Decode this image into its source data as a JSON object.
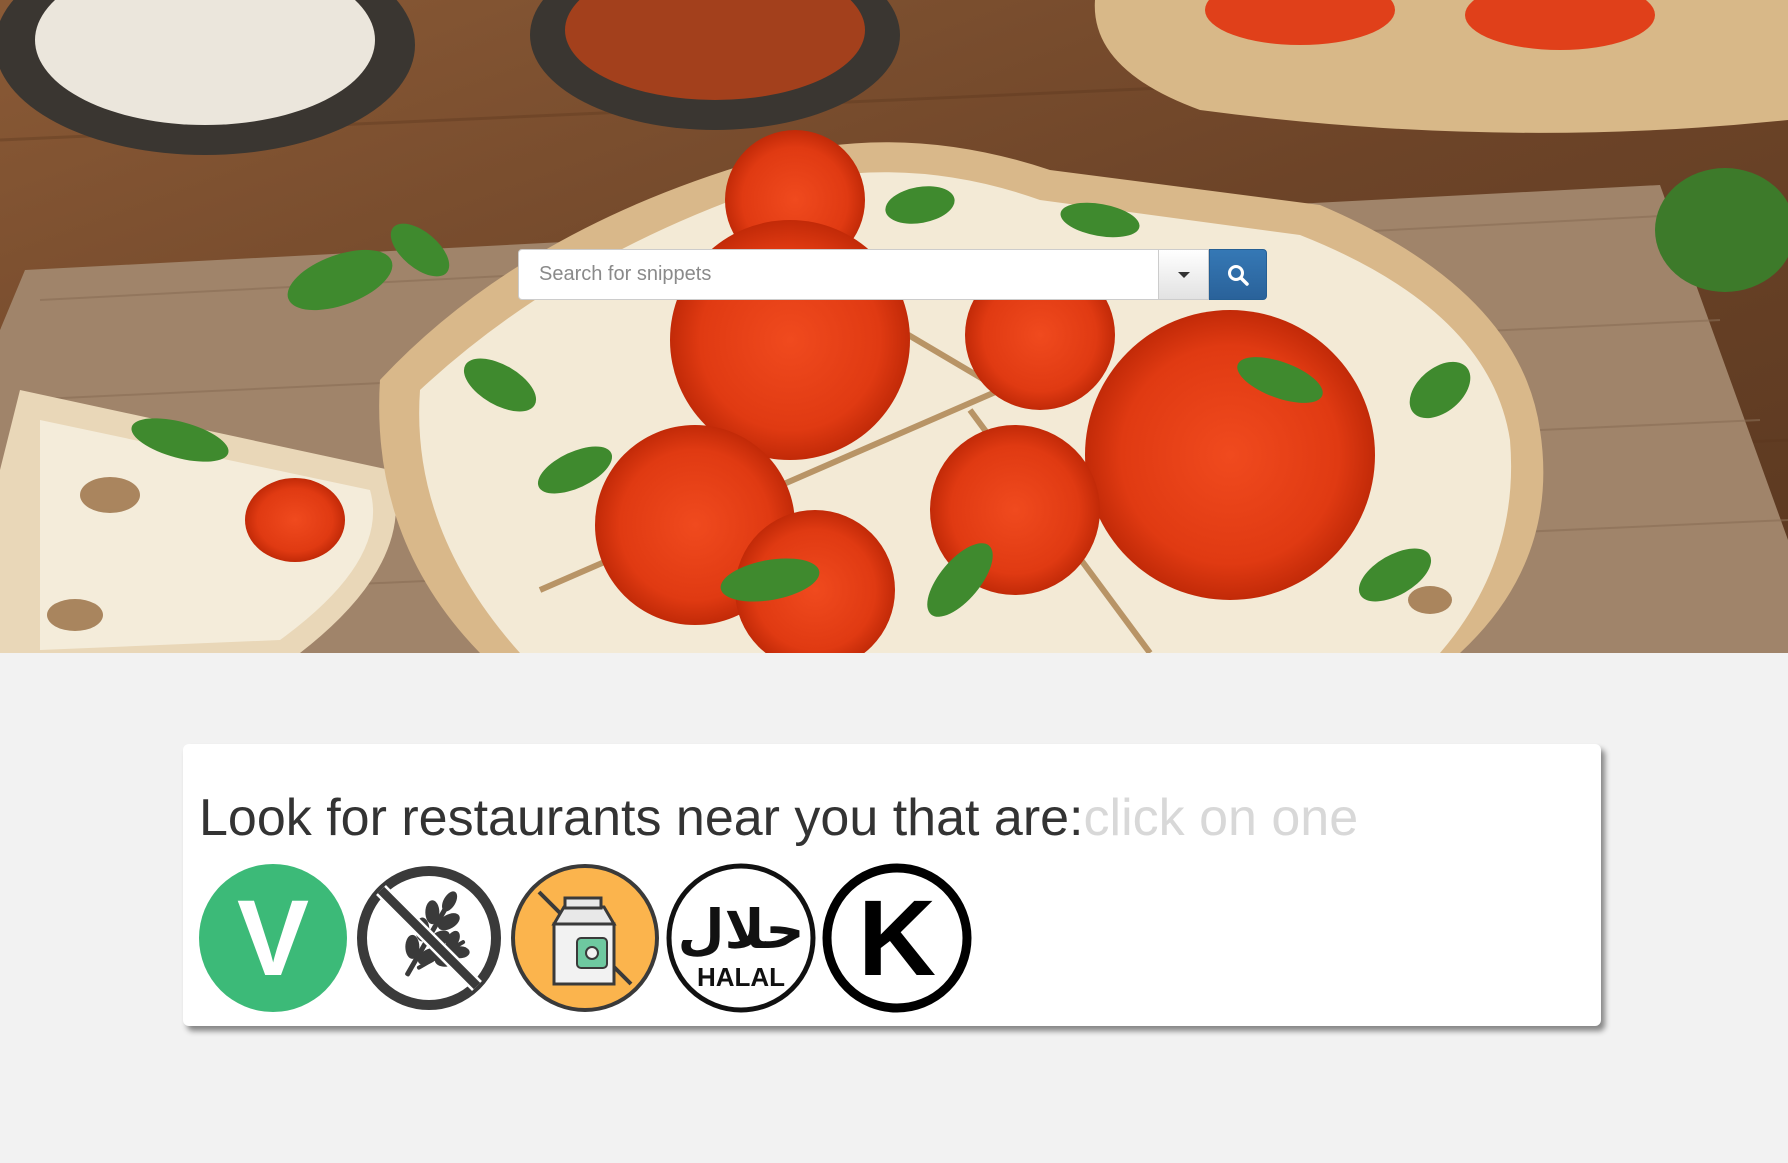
{
  "search": {
    "placeholder": "Search for snippets",
    "value": ""
  },
  "filter": {
    "heading": "Look for restaurants near you that are:",
    "hint": "click on one",
    "options": [
      {
        "icon": "vegan-icon",
        "letter": "V",
        "color": "#3cba78"
      },
      {
        "icon": "gluten-free-icon"
      },
      {
        "icon": "dairy-free-icon",
        "color": "#fbb44d"
      },
      {
        "icon": "halal-icon",
        "arabic": "حلال",
        "label": "HALAL"
      },
      {
        "icon": "kosher-icon",
        "letter": "K"
      }
    ]
  },
  "colors": {
    "page_background": "#f2f2f2",
    "search_button": "#2e6da4",
    "card_background": "#ffffff"
  }
}
